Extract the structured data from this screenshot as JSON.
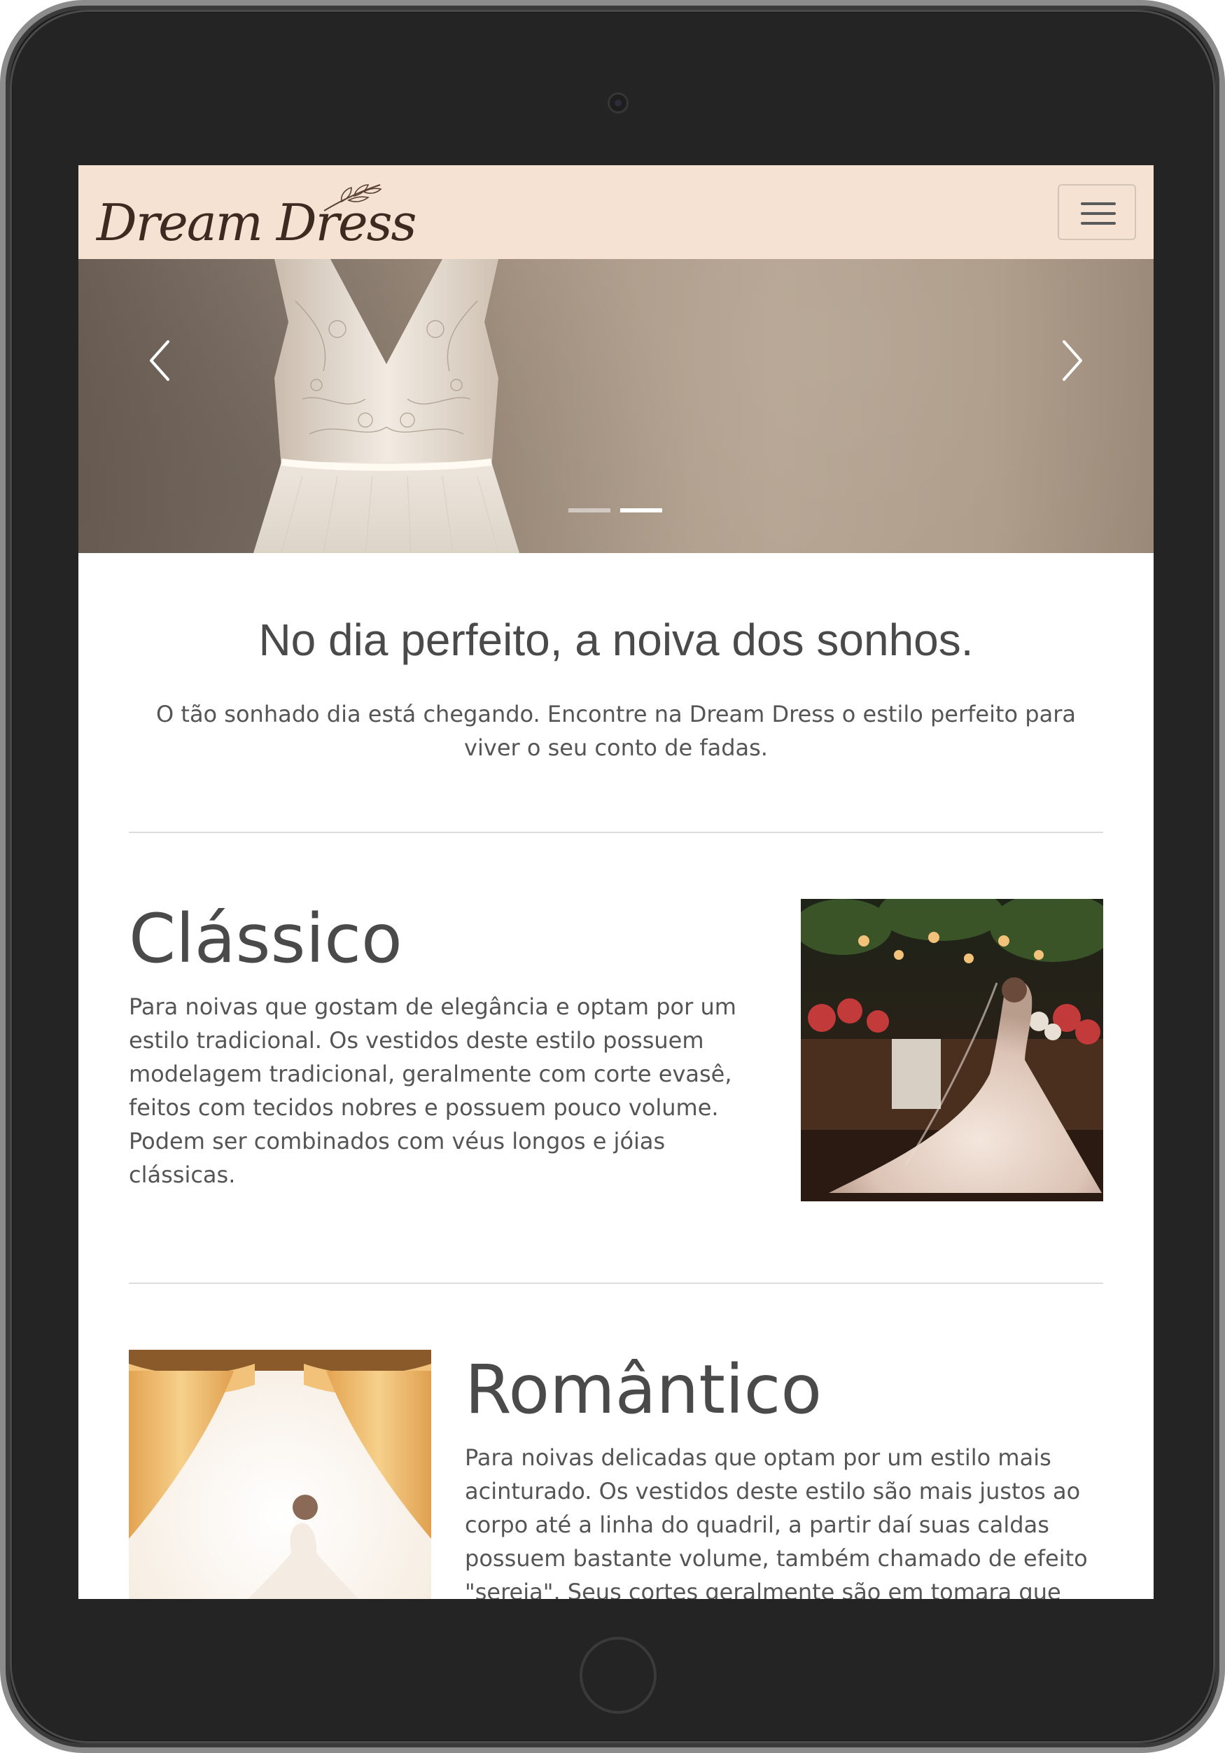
{
  "navbar": {
    "brand": "Dream Dress",
    "menu_icon": "hamburger-menu-icon"
  },
  "carousel": {
    "prev_icon": "chevron-left-icon",
    "next_icon": "chevron-right-icon",
    "slides_total": 2,
    "active_slide": 2
  },
  "intro": {
    "title": "No dia perfeito, a noiva dos sonhos.",
    "text": "O tão sonhado dia está chegando. Encontre na Dream Dress o estilo perfeito para viver o seu conto de fadas."
  },
  "sections": [
    {
      "title": "Clássico",
      "text": "Para noivas que gostam de elegância e optam por um estilo tradicional. Os vestidos deste estilo possuem modelagem tradicional, geralmente com corte evasê, feitos com tecidos nobres e possuem pouco volume. Podem ser combinados com véus longos e jóias clássicas."
    },
    {
      "title": "Romântico",
      "text": "Para noivas delicadas que optam por um estilo mais acinturado. Os vestidos deste estilo são mais justos ao corpo até a linha do quadril, a partir daí suas caldas possuem bastante volume, também chamado de efeito \"sereia\". Seus cortes geralmente são em tomara que"
    }
  ],
  "colors": {
    "navbar_bg": "#f6e2d3",
    "text": "#4a4a4a",
    "device_frame": "#242424"
  }
}
